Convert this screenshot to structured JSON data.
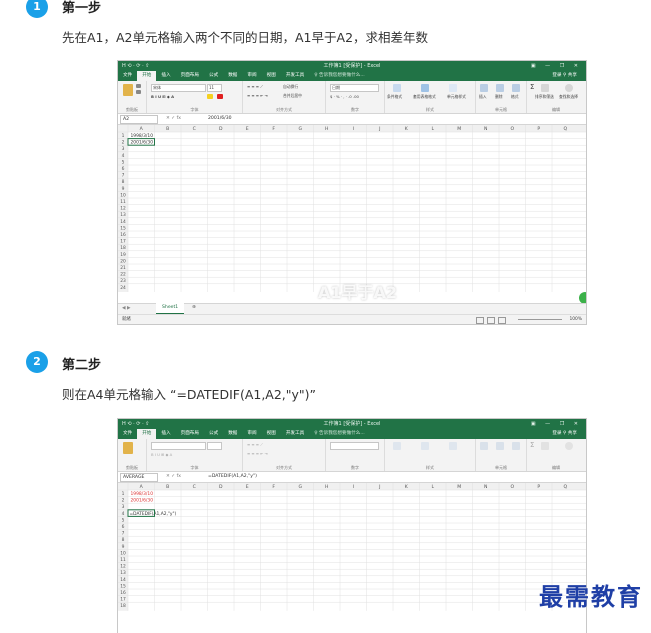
{
  "steps": [
    {
      "number": "1",
      "title": "第一步",
      "description": "先在A1，A2单元格输入两个不同的日期，A1早于A2，求相差年数",
      "screenshot": {
        "window_title": "工作簿1 [受保护] - Excel",
        "qat": "H ⟲ · ⟳ · ⇧",
        "window_controls": "▣ — ❐ ✕",
        "tabs": [
          "文件",
          "开始",
          "插入",
          "页面布局",
          "公式",
          "数据",
          "审阅",
          "视图",
          "开发工具"
        ],
        "active_tab": "开始",
        "tell_me": "♀ 告诉我您想要做什么...",
        "account": "登录  ⚲ 共享",
        "font_name": "宋体",
        "font_size": "11",
        "number_format": "日期",
        "wrap_label": "自动换行",
        "merge_label": "合并后居中",
        "group_labels": [
          "剪贴板",
          "字体",
          "对齐方式",
          "数字",
          "样式",
          "单元格",
          "编辑"
        ],
        "style_labels": [
          "条件格式",
          "套用表格格式",
          "单元格样式"
        ],
        "cell_labels": [
          "插入",
          "删除",
          "格式"
        ],
        "edit_labels": [
          "排序和筛选",
          "查找和选择"
        ],
        "name_box": "A2",
        "fx": "✕ ✓ fx",
        "formula": "2001/6/30",
        "columns": [
          "A",
          "B",
          "C",
          "D",
          "E",
          "F",
          "G",
          "H",
          "I",
          "J",
          "K",
          "L",
          "M",
          "N",
          "O",
          "P",
          "Q"
        ],
        "row_count": 24,
        "cells": [
          {
            "ref": "A1",
            "value": "1998/3/10"
          },
          {
            "ref": "A2",
            "value": "2001/6/30"
          }
        ],
        "overlay_text": "A1早于A2",
        "sheet_tab": "Sheet1",
        "sheet_add": "⊕",
        "status": "就绪",
        "zoom": "100%"
      }
    },
    {
      "number": "2",
      "title": "第二步",
      "description": "则在A4单元格输入 “=DATEDIF(A1,A2,\"y\")”",
      "screenshot": {
        "window_title": "工作簿1 [受保护] - Excel",
        "qat": "H ⟲ · ⟳ · ⇧",
        "window_controls": "▣ — ❐ ✕",
        "tabs": [
          "文件",
          "开始",
          "插入",
          "页面布局",
          "公式",
          "数据",
          "审阅",
          "视图",
          "开发工具"
        ],
        "active_tab": "开始",
        "tell_me": "♀ 告诉我您想要做什么...",
        "account": "登录  ⚲ 共享",
        "group_labels": [
          "剪贴板",
          "字体",
          "对齐方式",
          "数字",
          "样式",
          "单元格",
          "编辑"
        ],
        "name_box": "AVERAGE",
        "fx": "✕ ✓ fx",
        "formula": "=DATEDIF(A1,A2,\"y\")",
        "columns": [
          "A",
          "B",
          "C",
          "D",
          "E",
          "F",
          "G",
          "H",
          "I",
          "J",
          "K",
          "L",
          "M",
          "N",
          "O",
          "P",
          "Q"
        ],
        "row_count": 18,
        "cells": [
          {
            "ref": "A1",
            "value": "1998/3/10"
          },
          {
            "ref": "A2",
            "value": "2001/6/30"
          },
          {
            "ref": "A4",
            "value": "=DATEDIF(A1,A2,\"y\")"
          }
        ]
      }
    }
  ],
  "watermark": "最需教育",
  "colors": {
    "badge": "#1aa0e8",
    "excel_green": "#217346",
    "watermark": "#1f3fa6"
  }
}
